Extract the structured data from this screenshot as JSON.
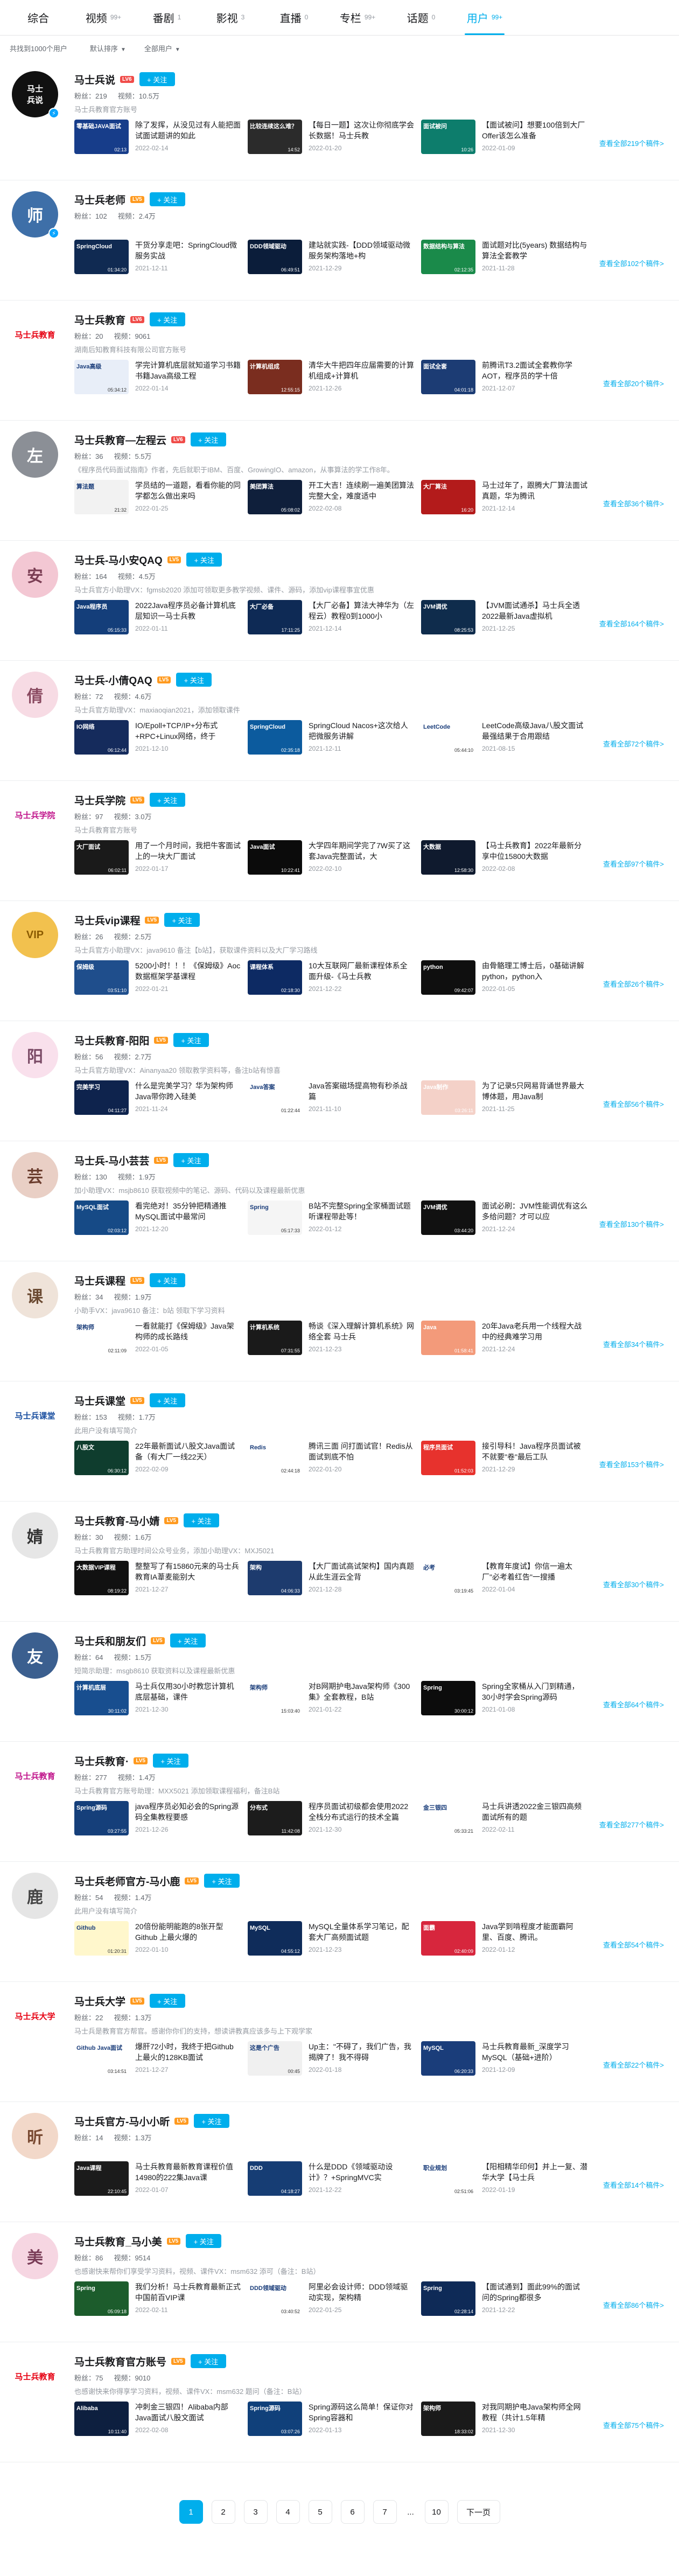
{
  "tabs": [
    {
      "label": "综合",
      "count": ""
    },
    {
      "label": "视频",
      "count": "99+"
    },
    {
      "label": "番剧",
      "count": "1"
    },
    {
      "label": "影视",
      "count": "3"
    },
    {
      "label": "直播",
      "count": "0"
    },
    {
      "label": "专栏",
      "count": "99+"
    },
    {
      "label": "话题",
      "count": "0"
    },
    {
      "label": "用户",
      "count": "99+"
    }
  ],
  "active_tab": 7,
  "filters": {
    "result": "共找到1000个用户",
    "sort": "默认排序",
    "type": "全部用户"
  },
  "follow_label": "+ 关注",
  "users": [
    {
      "name": "马士兵说",
      "level": "LV6",
      "level_color": "#f04c49",
      "fans": "粉丝：219",
      "videos": "视频：10.5万",
      "sign": "马士兵教育官方账号",
      "avatar_text": "马士\n兵说",
      "avatar_bg": "#111111",
      "avatar_fg": "#ffffff",
      "verified": true,
      "more": "查看全部219个稿件>",
      "videos_list": [
        {
          "title": "除了发挥，从没见过有人能把面试面试题讲的如此",
          "date": "2022-02-14",
          "thumb_bg": "#173d8a",
          "thumb_text": "零基础JAVA面试",
          "dur": "02:13"
        },
        {
          "title": "【每日一题】这次让你彻底学会长数据！马士兵教",
          "date": "2022-01-20",
          "thumb_bg": "#2b2b2b",
          "thumb_text": "比较连续这么难？",
          "dur": "14:52"
        },
        {
          "title": "【面试被问】想要100倍到大厂Offer该怎么准备",
          "date": "2022-01-09",
          "thumb_bg": "#0d7d6c",
          "thumb_text": "面试被问",
          "dur": "10:26"
        }
      ]
    },
    {
      "name": "马士兵老师",
      "level": "LV5",
      "level_color": "#ff9a1f",
      "fans": "粉丝：102",
      "videos": "视频：2.4万",
      "sign": "",
      "avatar_text": "师",
      "avatar_bg": "#3e6fa8",
      "avatar_fg": "#ffffff",
      "verified": true,
      "more": "查看全部102个稿件>",
      "videos_list": [
        {
          "title": "干货分享走吧：SpringCloud微服务实战",
          "date": "2021-12-11",
          "thumb_bg": "#102a52",
          "thumb_text": "SpringCloud",
          "dur": "01:34:20"
        },
        {
          "title": "建站就实践-【DDD领域驱动微服务架构落地+构",
          "date": "2021-12-29",
          "thumb_bg": "#0b1d3a",
          "thumb_text": "DDD领域驱动",
          "dur": "06:49:51"
        },
        {
          "title": "面试题对比(5years) 数据结构与算法全套教学",
          "date": "2021-11-28",
          "thumb_bg": "#1a8a4a",
          "thumb_text": "数据结构与算法",
          "dur": "02:12:35"
        }
      ]
    },
    {
      "name": "马士兵教育",
      "level": "LV6",
      "level_color": "#f04c49",
      "fans": "粉丝：20",
      "videos": "视频：9061",
      "sign": "湖南后知教育科技有限公司官方账号",
      "avatar_text": "马士兵教育",
      "avatar_bg": "#ffffff",
      "avatar_fg": "#e60012",
      "verified": false,
      "more": "查看全部20个稿件>",
      "videos_list": [
        {
          "title": "学完计算机底层就知道学习书籍书籍Java高级工程",
          "date": "2022-01-14",
          "thumb_bg": "#e8eef8",
          "thumb_text": "Java高级",
          "dur": "05:34:12"
        },
        {
          "title": "清华大牛把四年应届需要的计算机组成+计算机",
          "date": "2021-12-26",
          "thumb_bg": "#7a2d1f",
          "thumb_text": "计算机组成",
          "dur": "12:55:15"
        },
        {
          "title": "前腾讯T3.2面试全套教你学AOT，程序员的学十倍",
          "date": "2021-12-07",
          "thumb_bg": "#1c3c74",
          "thumb_text": "面试全套",
          "dur": "04:01:18"
        }
      ]
    },
    {
      "name": "马士兵教育—左程云",
      "level": "LV6",
      "level_color": "#f04c49",
      "fans": "粉丝：36",
      "videos": "视频：5.5万",
      "sign": "《程序员代码面试指南》作者，先后就职于IBM、百度、GrowingIO、amazon，从事算法的学工作8年。",
      "avatar_text": "左",
      "avatar_bg": "#8b8f96",
      "avatar_fg": "#ffffff",
      "verified": false,
      "more": "查看全部36个稿件>",
      "videos_list": [
        {
          "title": "学员结的一道题，看看你能的同学都怎么做出来吗",
          "date": "2022-01-25",
          "thumb_bg": "#f2f2f2",
          "thumb_text": "算法题",
          "dur": "21:32"
        },
        {
          "title": "开工大吉！连续刷一遍美团算法完整大全，难度适中",
          "date": "2022-02-08",
          "thumb_bg": "#0f1f3b",
          "thumb_text": "美团算法",
          "dur": "05:08:02"
        },
        {
          "title": "马士过年了，跟腾大厂算法面试真题，华为腾讯",
          "date": "2021-12-14",
          "thumb_bg": "#b31b1b",
          "thumb_text": "大厂算法",
          "dur": "16:20"
        }
      ]
    },
    {
      "name": "马士兵-马小安QAQ",
      "level": "LV5",
      "level_color": "#ff9a1f",
      "fans": "粉丝：164",
      "videos": "视频：4.5万",
      "sign": "马士兵官方小助理VX：fgmsb2020 添加可领取更多教学视频、课件、源码，添加vip课程事宜优惠",
      "avatar_text": "安",
      "avatar_bg": "#f3c7d3",
      "avatar_fg": "#7a3d53",
      "verified": false,
      "more": "查看全部164个稿件>",
      "videos_list": [
        {
          "title": "2022Java程序员必备计算机底层知识一马士兵教",
          "date": "2022-01-11",
          "thumb_bg": "#143e7a",
          "thumb_text": "Java程序员",
          "dur": "05:15:33"
        },
        {
          "title": "【大厂必备】算法大神华为（左程云）教程0到1000小",
          "date": "2021-12-14",
          "thumb_bg": "#0e2a55",
          "thumb_text": "大厂必备",
          "dur": "17:11:25"
        },
        {
          "title": "【JVM面试通杀】马士兵全透2022最新Java虚拟机",
          "date": "2021-12-25",
          "thumb_bg": "#0f2c4c",
          "thumb_text": "JVM调优",
          "dur": "08:25:53"
        }
      ]
    },
    {
      "name": "马士兵-小倩QAQ",
      "level": "LV5",
      "level_color": "#ff9a1f",
      "fans": "粉丝：72",
      "videos": "视频：4.6万",
      "sign": "马士兵官方助理VX：maxiaoqian2021，添加领取课件",
      "avatar_text": "倩",
      "avatar_bg": "#f7dbe4",
      "avatar_fg": "#8a4a61",
      "verified": false,
      "more": "查看全部72个稿件>",
      "videos_list": [
        {
          "title": "IO/Epoll+TCP/IP+分布式+RPC+Linux网络，终于",
          "date": "2021-12-10",
          "thumb_bg": "#152b5c",
          "thumb_text": "IO网络",
          "dur": "06:12:44"
        },
        {
          "title": "SpringCloud Nacos+这次给人把微服务讲解",
          "date": "2021-12-11",
          "thumb_bg": "#0c5b9e",
          "thumb_text": "SpringCloud",
          "dur": "02:35:18"
        },
        {
          "title": "LeetCode高级Java八股文面试最强结果于合用跟结",
          "date": "2021-08-15",
          "thumb_bg": "#ffffff",
          "thumb_text": "LeetCode",
          "dur": "05:44:10"
        }
      ]
    },
    {
      "name": "马士兵学院",
      "level": "LV5",
      "level_color": "#ff9a1f",
      "fans": "粉丝：97",
      "videos": "视频：3.0万",
      "sign": "马士兵教育官方账号",
      "avatar_text": "马士兵学院",
      "avatar_bg": "#ffffff",
      "avatar_fg": "#c0138a",
      "verified": false,
      "more": "查看全部97个稿件>",
      "videos_list": [
        {
          "title": "用了一个月时间，我把牛客面试上的一块大厂面试",
          "date": "2022-01-17",
          "thumb_bg": "#1a1a1a",
          "thumb_text": "大厂面试",
          "dur": "06:02:11"
        },
        {
          "title": "大学四年期间学完了7W买了这套Java完整面试，大",
          "date": "2022-02-10",
          "thumb_bg": "#0b0b0b",
          "thumb_text": "Java面试",
          "dur": "10:22:41"
        },
        {
          "title": "【马士兵教育】2022年最新分享中位15800大数据",
          "date": "2022-02-08",
          "thumb_bg": "#0f1a2e",
          "thumb_text": "大数据",
          "dur": "12:58:30"
        }
      ]
    },
    {
      "name": "马士兵vip课程",
      "level": "LV5",
      "level_color": "#ff9a1f",
      "fans": "粉丝：26",
      "videos": "视频：2.5万",
      "sign": "马士兵官方小助理VX：java9610 备注【b站】，获取课件资料以及大厂学习路线",
      "avatar_text": "VIP",
      "avatar_bg": "#f2c14e",
      "avatar_fg": "#8a5a00",
      "verified": false,
      "more": "查看全部26个稿件>",
      "videos_list": [
        {
          "title": "5200小时！！！《保姆级》Aoc数据框架学基课程",
          "date": "2022-01-21",
          "thumb_bg": "#1f4e8c",
          "thumb_text": "保姆级",
          "dur": "03:51:10"
        },
        {
          "title": "10大互联网厂最新课程体系全面升级-《马士兵教",
          "date": "2021-12-22",
          "thumb_bg": "#0d2a63",
          "thumb_text": "课程体系",
          "dur": "02:18:30"
        },
        {
          "title": "由骨骼理工博士后，0基础讲解python，python入",
          "date": "2022-01-05",
          "thumb_bg": "#0f0f0f",
          "thumb_text": "python",
          "dur": "09:42:07"
        }
      ]
    },
    {
      "name": "马士兵教育-阳阳",
      "level": "LV5",
      "level_color": "#ff9a1f",
      "fans": "粉丝：56",
      "videos": "视频：2.7万",
      "sign": "马士兵官方助理VX：Ainanyaa20 领取教学资料等，备注b站有惊喜",
      "avatar_text": "阳",
      "avatar_bg": "#f9e0ec",
      "avatar_fg": "#7a4a65",
      "verified": false,
      "more": "查看全部56个稿件>",
      "videos_list": [
        {
          "title": "什么是完美学习？华为架构师Java带你跨入硅美",
          "date": "2021-11-24",
          "thumb_bg": "#0e234d",
          "thumb_text": "完美学习",
          "dur": "04:11:27"
        },
        {
          "title": "Java答案磁场提高物有秒杀战篇",
          "date": "2021-11-10",
          "thumb_bg": "#ffffff",
          "thumb_text": "Java答案",
          "dur": "01:22:44"
        },
        {
          "title": "为了记录5只网易背诵世界最大博体题，用Java制",
          "date": "2021-11-25",
          "thumb_bg": "#f4d1c8",
          "thumb_text": "Java制作",
          "dur": "03:26:11"
        }
      ]
    },
    {
      "name": "马士兵-马小芸芸",
      "level": "LV5",
      "level_color": "#ff9a1f",
      "fans": "粉丝：130",
      "videos": "视频：1.9万",
      "sign": "加小助理VX：msjb8610 获取视频中的笔记、源码、代码以及课程最新优惠",
      "avatar_text": "芸",
      "avatar_bg": "#e9cfc5",
      "avatar_fg": "#6b3d2e",
      "verified": false,
      "more": "查看全部130个稿件>",
      "videos_list": [
        {
          "title": "看完绝对！35分钟把精通推MySQL面试中最常问",
          "date": "2021-12-20",
          "thumb_bg": "#164a86",
          "thumb_text": "MySQL面试",
          "dur": "02:03:12"
        },
        {
          "title": "B站不完整Spring全家桶面试题听课程带赴等！",
          "date": "2022-01-12",
          "thumb_bg": "#f5f5f5",
          "thumb_text": "Spring",
          "dur": "05:17:33"
        },
        {
          "title": "面试必刷：JVM性能调优有这么多给问题？才可以应",
          "date": "2021-12-24",
          "thumb_bg": "#111111",
          "thumb_text": "JVM调优",
          "dur": "03:44:20"
        }
      ]
    },
    {
      "name": "马士兵课程",
      "level": "LV5",
      "level_color": "#ff9a1f",
      "fans": "粉丝：34",
      "videos": "视频：1.9万",
      "sign": "小助手VX：java9610 备注：b站 领取下学习资料",
      "avatar_text": "课",
      "avatar_bg": "#efe3d9",
      "avatar_fg": "#6b4a32",
      "verified": false,
      "more": "查看全部34个稿件>",
      "videos_list": [
        {
          "title": "一看就能打《保姆级》Java架构师的成长路线",
          "date": "2022-01-05",
          "thumb_bg": "#ffffff",
          "thumb_text": "架构师",
          "dur": "02:11:09"
        },
        {
          "title": "畅谈《深入理解计算机系统》网络全套 马士兵",
          "date": "2021-12-23",
          "thumb_bg": "#1a1a1a",
          "thumb_text": "计算机系统",
          "dur": "07:31:55"
        },
        {
          "title": "20年Java老兵用一个线程大战中的经典难学习用",
          "date": "2021-12-24",
          "thumb_bg": "#f39a7a",
          "thumb_text": "Java",
          "dur": "01:58:41"
        }
      ]
    },
    {
      "name": "马士兵课堂",
      "level": "LV5",
      "level_color": "#ff9a1f",
      "fans": "粉丝：153",
      "videos": "视频：1.7万",
      "sign": "此用户没有填写简介",
      "avatar_text": "马士兵课堂",
      "avatar_bg": "#ffffff",
      "avatar_fg": "#1a4fa0",
      "verified": false,
      "more": "查看全部153个稿件>",
      "videos_list": [
        {
          "title": "22年最新面试八股文Java面试备（有大厂一线22天）",
          "date": "2022-02-09",
          "thumb_bg": "#0f3d2e",
          "thumb_text": "八股文",
          "dur": "06:30:12"
        },
        {
          "title": "腾讯三面 问打面试官！Redis从面试到底不怕",
          "date": "2022-01-20",
          "thumb_bg": "#ffffff",
          "thumb_text": "Redis",
          "dur": "02:44:18"
        },
        {
          "title": "接引导科！Java程序员面试被不就要\"卷\"最后工队",
          "date": "2021-12-29",
          "thumb_bg": "#e7322d",
          "thumb_text": "程序员面试",
          "dur": "01:52:03"
        }
      ]
    },
    {
      "name": "马士兵教育-马小婧",
      "level": "LV5",
      "level_color": "#ff9a1f",
      "fans": "粉丝：30",
      "videos": "视频：1.6万",
      "sign": "马士兵教育官方助理时间公众号业务，添加小助理VX：MXJ5021",
      "avatar_text": "婧",
      "avatar_bg": "#e6e6e6",
      "avatar_fg": "#333333",
      "verified": false,
      "more": "查看全部30个稿件>",
      "videos_list": [
        {
          "title": "整整写了有15860元来的马士兵教育IA葦麦能别大",
          "date": "2021-12-27",
          "thumb_bg": "#111111",
          "thumb_text": "大数据VIP课程",
          "dur": "08:19:22"
        },
        {
          "title": "【大厂面试高试架构】国内真题从此生涯云全背",
          "date": "2021-12-28",
          "thumb_bg": "#1d3b6e",
          "thumb_text": "架构",
          "dur": "04:06:33"
        },
        {
          "title": "【教育年度试】你信一遍太厂\"必考着红告\"一搜播",
          "date": "2022-01-04",
          "thumb_bg": "#ffffff",
          "thumb_text": "必考",
          "dur": "03:19:45"
        }
      ]
    },
    {
      "name": "马士兵和朋友们",
      "level": "LV5",
      "level_color": "#ff9a1f",
      "fans": "粉丝：64",
      "videos": "视频：1.5万",
      "sign": "短简示助理：msgb8610 获取资料以及课程最新优惠",
      "avatar_text": "友",
      "avatar_bg": "#3b5f8f",
      "avatar_fg": "#ffffff",
      "verified": false,
      "more": "查看全部64个稿件>",
      "videos_list": [
        {
          "title": "马士兵仅用30小时教您计算机底层基础，课件",
          "date": "2021-12-30",
          "thumb_bg": "#184e8f",
          "thumb_text": "计算机底层",
          "dur": "30:11:02"
        },
        {
          "title": "对B网期护电Java架构师《300集》全套教程，B站",
          "date": "2021-01-22",
          "thumb_bg": "#ffffff",
          "thumb_text": "架构师",
          "dur": "15:03:40"
        },
        {
          "title": "Spring全家桶从入门到精通，30小时学会Spring源码",
          "date": "2021-01-08",
          "thumb_bg": "#0c0c0c",
          "thumb_text": "Spring",
          "dur": "30:00:12"
        }
      ]
    },
    {
      "name": "马士兵教育·",
      "level": "LV5",
      "level_color": "#ff9a1f",
      "fans": "粉丝：277",
      "videos": "视频：1.4万",
      "sign": "马士兵教育官方账号助理：MXX5021 添加领取课程福利，备注B站",
      "avatar_text": "马士兵教育",
      "avatar_bg": "#ffffff",
      "avatar_fg": "#c0138a",
      "verified": false,
      "more": "查看全部277个稿件>",
      "videos_list": [
        {
          "title": "java程序员必知必会的Spring源码全集教程要感",
          "date": "2021-12-26",
          "thumb_bg": "#153f7a",
          "thumb_text": "Spring源码",
          "dur": "03:27:55"
        },
        {
          "title": "程序员面试初级都会使用2022全栈分布式运行的技术全篇",
          "date": "2021-12-30",
          "thumb_bg": "#1c1c1c",
          "thumb_text": "分布式",
          "dur": "11:42:08"
        },
        {
          "title": "马士兵讲透2022金三银四高频面试所有的题",
          "date": "2022-02-11",
          "thumb_bg": "#ffffff",
          "thumb_text": "金三银四",
          "dur": "05:33:21"
        }
      ]
    },
    {
      "name": "马士兵老师官方-马小鹿",
      "level": "LV5",
      "level_color": "#ff9a1f",
      "fans": "粉丝：54",
      "videos": "视频：1.4万",
      "sign": "此用户没有填写简介",
      "avatar_text": "鹿",
      "avatar_bg": "#e5e5e5",
      "avatar_fg": "#444444",
      "verified": false,
      "more": "查看全部54个稿件>",
      "videos_list": [
        {
          "title": "20倍份能明能跑的8张开型 Github 上最火爆的",
          "date": "2022-01-10",
          "thumb_bg": "#fff7cc",
          "thumb_text": "Github",
          "dur": "01:20:31"
        },
        {
          "title": "MySQL全量体系学习笔记，配套大厂高频面试题",
          "date": "2021-12-23",
          "thumb_bg": "#0f2c5a",
          "thumb_text": "MySQL",
          "dur": "04:55:12"
        },
        {
          "title": "Java学到啃程度才能面霸阿里、百度、腾讯。",
          "date": "2022-01-12",
          "thumb_bg": "#d7263d",
          "thumb_text": "面霸",
          "dur": "02:40:09"
        }
      ]
    },
    {
      "name": "马士兵大学",
      "level": "LV5",
      "level_color": "#ff9a1f",
      "fans": "粉丝：22",
      "videos": "视频：1.3万",
      "sign": "马士兵是教育官方帮官。感谢你你们的支持，想读讲教真应该多与上下观学家",
      "avatar_text": "马士兵大学",
      "avatar_bg": "#ffffff",
      "avatar_fg": "#e60012",
      "verified": false,
      "more": "查看全部22个稿件>",
      "videos_list": [
        {
          "title": "爆肝72小时，我终于把Github上最火的128KB面试",
          "date": "2021-12-27",
          "thumb_bg": "#ffffff",
          "thumb_text": "Github Java面试",
          "dur": "03:14:51"
        },
        {
          "title": "Up主：\"不碍了，我们广告，我揭牌了！我不得碍",
          "date": "2022-01-18",
          "thumb_bg": "#f0f0f0",
          "thumb_text": "这是个广告",
          "dur": "00:45"
        },
        {
          "title": "马士兵教育最新_深度学习MySQL（基础+进阶）",
          "date": "2021-12-09",
          "thumb_bg": "#1a3d7a",
          "thumb_text": "MySQL",
          "dur": "06:20:33"
        }
      ]
    },
    {
      "name": "马士兵官方-马小小昕",
      "level": "LV5",
      "level_color": "#ff9a1f",
      "fans": "粉丝：14",
      "videos": "视频：1.3万",
      "sign": "",
      "avatar_text": "昕",
      "avatar_bg": "#f2d8c9",
      "avatar_fg": "#7a4a32",
      "verified": false,
      "more": "查看全部14个稿件>",
      "videos_list": [
        {
          "title": "马士兵教育最新教育课程价值14980的222集Java课",
          "date": "2022-01-07",
          "thumb_bg": "#1b1b1b",
          "thumb_text": "Java课程",
          "dur": "22:10:45"
        },
        {
          "title": "什么是DDD《领域驱动设计》？+SpringMVC实",
          "date": "2021-12-22",
          "thumb_bg": "#163d74",
          "thumb_text": "DDD",
          "dur": "04:18:27"
        },
        {
          "title": "【阳相精华印何】并上一复、潜华大学【马士兵",
          "date": "2022-01-19",
          "thumb_bg": "#ffffff",
          "thumb_text": "职业规划",
          "dur": "02:51:06"
        }
      ]
    },
    {
      "name": "马士兵教育_马小美",
      "level": "LV5",
      "level_color": "#ff9a1f",
      "fans": "粉丝：86",
      "videos": "视频：9514",
      "sign": "也感谢快来帮你们享受学习资料，视频、课件VX：msm632 添可（备注：B站）",
      "avatar_text": "美",
      "avatar_bg": "#f6d6e2",
      "avatar_fg": "#7a3d58",
      "verified": false,
      "more": "查看全部86个稿件>",
      "videos_list": [
        {
          "title": "我们分析！马士兵教育最新正式中国前百VIP课",
          "date": "2022-02-11",
          "thumb_bg": "#1c5c2c",
          "thumb_text": "Spring",
          "dur": "05:09:18"
        },
        {
          "title": "阿里必会设计师：DDD领域驱动实现，架构精",
          "date": "2022-01-25",
          "thumb_bg": "#ffffff",
          "thumb_text": "DDD领域驱动",
          "dur": "03:40:52"
        },
        {
          "title": "【面试通到】面此99%的面试问的Spring都很多",
          "date": "2021-12-22",
          "thumb_bg": "#0e2a57",
          "thumb_text": "Spring",
          "dur": "02:28:14"
        }
      ]
    },
    {
      "name": "马士兵教育官方账号",
      "level": "LV5",
      "level_color": "#ff9a1f",
      "fans": "粉丝：75",
      "videos": "视频：9010",
      "sign": "也感谢快来你得享学习资料，视频、课件VX：msm632 题问（备注：B站）",
      "avatar_text": "马士兵教育",
      "avatar_bg": "#ffffff",
      "avatar_fg": "#e60012",
      "verified": false,
      "more": "查看全部75个稿件>",
      "videos_list": [
        {
          "title": "冲刺金三银四！Alibaba内部Java面试八股文面试",
          "date": "2022-02-08",
          "thumb_bg": "#0d1f3f",
          "thumb_text": "Alibaba",
          "dur": "10:11:40"
        },
        {
          "title": "Spring源码这么简单！保证你对Spring容器和",
          "date": "2022-01-13",
          "thumb_bg": "#10407a",
          "thumb_text": "Spring源码",
          "dur": "03:07:26"
        },
        {
          "title": "对我同期护电Java架构师全网教程（共计1.5年精",
          "date": "2021-12-30",
          "thumb_bg": "#1a1a1a",
          "thumb_text": "架构师",
          "dur": "18:33:02"
        }
      ]
    }
  ],
  "pagination": {
    "pages": [
      "1",
      "2",
      "3",
      "4",
      "5",
      "6",
      "7"
    ],
    "ellipsis": "...",
    "last": "10",
    "next": "下一页",
    "current": "1"
  }
}
